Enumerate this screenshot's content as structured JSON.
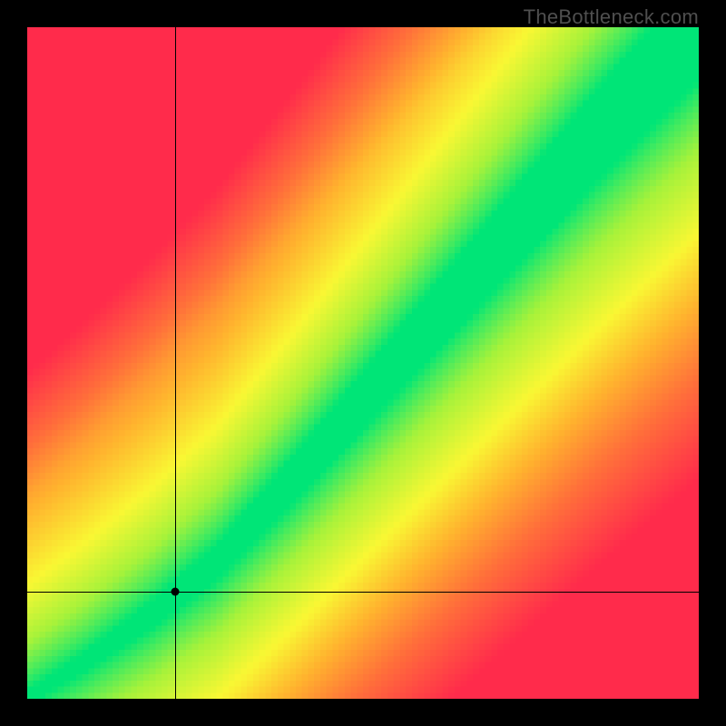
{
  "watermark": "TheBottleneck.com",
  "chart_data": {
    "type": "heatmap",
    "title": "",
    "xlabel": "",
    "ylabel": "",
    "xlim": [
      0,
      100
    ],
    "ylim": [
      0,
      100
    ],
    "grid": false,
    "legend": false,
    "description": "Optimal-pairing heatmap. Green diagonal band = balanced, fading through yellow/orange to red away from diagonal. Lower-left origin.",
    "color_stops": [
      {
        "t": 0.0,
        "hex": "#00e577"
      },
      {
        "t": 0.18,
        "hex": "#a7f23a"
      },
      {
        "t": 0.35,
        "hex": "#f9f733"
      },
      {
        "t": 0.55,
        "hex": "#ffb22e"
      },
      {
        "t": 0.75,
        "hex": "#ff6f3a"
      },
      {
        "t": 1.0,
        "hex": "#ff2b4b"
      }
    ],
    "ridge_points": [
      {
        "x": 0,
        "y": 0
      },
      {
        "x": 8,
        "y": 5
      },
      {
        "x": 18,
        "y": 12
      },
      {
        "x": 28,
        "y": 20
      },
      {
        "x": 40,
        "y": 33
      },
      {
        "x": 55,
        "y": 50
      },
      {
        "x": 70,
        "y": 67
      },
      {
        "x": 85,
        "y": 84
      },
      {
        "x": 100,
        "y": 100
      }
    ],
    "band_width": {
      "at_0": 2,
      "at_100": 16
    },
    "marker": {
      "x": 22,
      "y": 16,
      "meaning": "selected configuration point"
    },
    "resolution": 110
  }
}
